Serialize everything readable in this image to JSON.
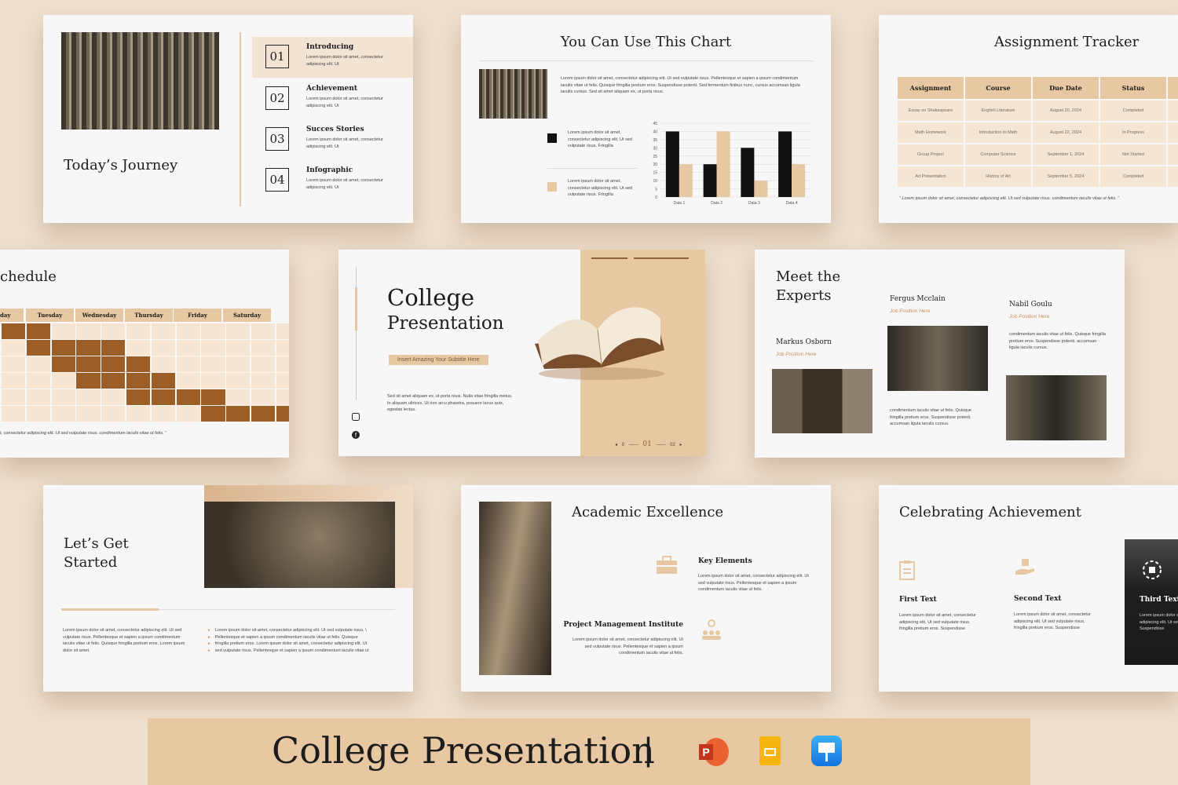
{
  "slide_journey": {
    "title": "Today’s Journey",
    "items": [
      {
        "num": "01",
        "title": "Introducing",
        "text": "Lorem ipsum dolor sit amet, consectetur adipiscing elit. Ut"
      },
      {
        "num": "02",
        "title": "Achievement",
        "text": "Lorem ipsum dolor sit amet, consectetur adipiscing elit. Ut"
      },
      {
        "num": "03",
        "title": "Succes Stories",
        "text": "Lorem ipsum dolor sit amet, consectetur adipiscing elit. Ut"
      },
      {
        "num": "04",
        "title": "Infographic",
        "text": "Lorem ipsum dolor sit amet, consectetur adipiscing elit. Ut"
      }
    ]
  },
  "slide_chart": {
    "title": "You Can Use This Chart",
    "paragraph": "Lorem ipsum dolor sit amet, consectetur adipiscing elit. Ut sed vulputate risus. Pellentesque et sapien a ipsum condimentum iaculis vitae ut felis. Quisque fringilla pretium eros. Suspendisse potenti. Sed fermentum finibus nunc, cursus accumsan ligula iaculis cursus. Sed sit amet aliquam ex, ut porta risus.",
    "legend": [
      {
        "text": "Lorem ipsum dolor sit amet, consectetur adipiscing elit. Ut sed vulputate risus. Fringilla",
        "color": "#111111"
      },
      {
        "text": "Lorem ipsum dolor sit amet, consectetur adipiscing elit. Ut sed vulputate risus. Fringilla",
        "color": "#e8c7a3"
      }
    ]
  },
  "chart_data": {
    "type": "bar",
    "categories": [
      "Data 1",
      "Data 2",
      "Data 3",
      "Data 4"
    ],
    "series": [
      {
        "values": [
          40,
          20,
          30,
          40
        ],
        "color": "#111111"
      },
      {
        "values": [
          20,
          40,
          10,
          20
        ],
        "color": "#e8c7a3"
      }
    ],
    "ylim": [
      0,
      45
    ],
    "yticks": [
      "0",
      "5",
      "10",
      "15",
      "20",
      "25",
      "30",
      "35",
      "40",
      "45"
    ],
    "grid": true
  },
  "slide_tracker": {
    "title": "Assignment Tracker",
    "headers": [
      "Assignment",
      "Course",
      "Due Date",
      "Status"
    ],
    "rows": [
      [
        "Essay on Shakespeare",
        "English Literature",
        "August 20, 2024",
        "Completed"
      ],
      [
        "Math Homework",
        "Introduction to Math",
        "August 22, 2024",
        "In Progress"
      ],
      [
        "Group Project",
        "Computer Science",
        "September 1, 2024",
        "Not Started"
      ],
      [
        "Art Presentation",
        "History of Art",
        "September 5, 2024",
        "Completed"
      ]
    ],
    "quote": "“ Lorem ipsum dolor sit amet, consectetur adipiscing elit. Ut sed vulputate risus. condimentum iaculis vitae ut felis. ”"
  },
  "slide_schedule": {
    "title": "chedule",
    "days": [
      "day",
      "Tuesday",
      "Wednesday",
      "Thursday",
      "Friday",
      "Saturday"
    ],
    "quote": "t, consectetur adipiscing elit. Ut sed vulputate risus. condimentum iaculis vitae ut felis. ”"
  },
  "slide_cover": {
    "title_line1": "College",
    "title_line2": "Presentation",
    "subtitle": "Insert Amazing Your Subtitle Here",
    "body": "Sed sit amet aliquam ex, ut porta risus. Nulla vitae fringilla metus. In aliquam ultrices. Ut non arcu pharetra, posuere lacus quis, egestas lectus.",
    "page_prev": "0",
    "page_current": "01",
    "page_next": "02"
  },
  "slide_experts": {
    "title_line1": "Meet the",
    "title_line2": "Experts",
    "people": [
      {
        "name": "Markus Osborn",
        "role": "Job Position Here"
      },
      {
        "name": "Fergus Mcclain",
        "role": "Job Position Here",
        "text": "condimentum iaculis vitae ut felis. Quisque fringilla pretium eros. Suspendisse potenti. accumsan ligula iaculis cursus."
      },
      {
        "name": "Nabil Goulu",
        "role": "Job Position Here",
        "text": "condimentum iaculis vitae ut felis. Quisque fringilla pretium eros. Suspendisse potenti. accumsan ligula iaculis cursus."
      }
    ]
  },
  "slide_started": {
    "title_line1": "Let’s Get",
    "title_line2": "Started",
    "left_text": "Lorem ipsum dolor sit amet, consectetur adipiscing elit. Ut sed vulputate risus. Pellentesque et sapien a ipsum condimentum iaculis vitae ut felis. Quisque fringilla pretium eros. Lorem ipsum dolor sit amet.",
    "bullets": [
      "Lorem ipsum dolor sit amet, consectetur adipiscing elit. Ut sed vulputate risus. \\",
      "Pellentesque et sapien a ipsum condimentum iaculis vitae ut felis. Quisque",
      "fringilla pretium eros. Lorem ipsum dolor sit amet, consectetur adipiscing elit. Ut",
      "sed vulputate risus. Pellentesque et sapien a ipsum condimentum iaculis vitae ut"
    ]
  },
  "slide_academic": {
    "title": "Academic Excellence",
    "key_title": "Key Elements",
    "key_text": "Lorem ipsum dolor sit amet, consectetur adipiscing elit. Ut sed vulputate risus. Pellentesque et sapien a ipsum condimentum iaculis vitae ut felis.",
    "pmi_title": "Project Management Institute",
    "pmi_text": "Lorem ipsum dolor sit amet, consectetur adipiscing elit. Ut sed vulputate risus. Pellentesque et sapien a ipsum condimentum iaculis vitae ut felis."
  },
  "slide_celebrate": {
    "title": "Celebrating Achievement",
    "items": [
      {
        "title": "First Text",
        "text": "Lorem ipsum dolor sit amet, consectetur adipiscing elit. Ut sed vulputate risus. fringilla pretium eros. Suspendisse"
      },
      {
        "title": "Second Text",
        "text": "Lorem ipsum dolor sit amet, consectetur adipiscing elit. Ut sed vulputate risus. fringilla pretium eros. Suspendisse"
      },
      {
        "title": "Third Text",
        "text": "Lorem ipsum dolor sit amet, consectetur adipiscing elit. Ut sed vulputate risus. Suspendisse"
      }
    ]
  },
  "banner": {
    "title": "College Presentation",
    "separator": "|",
    "apps": [
      "powerpoint-icon",
      "google-slides-icon",
      "keynote-icon"
    ]
  }
}
